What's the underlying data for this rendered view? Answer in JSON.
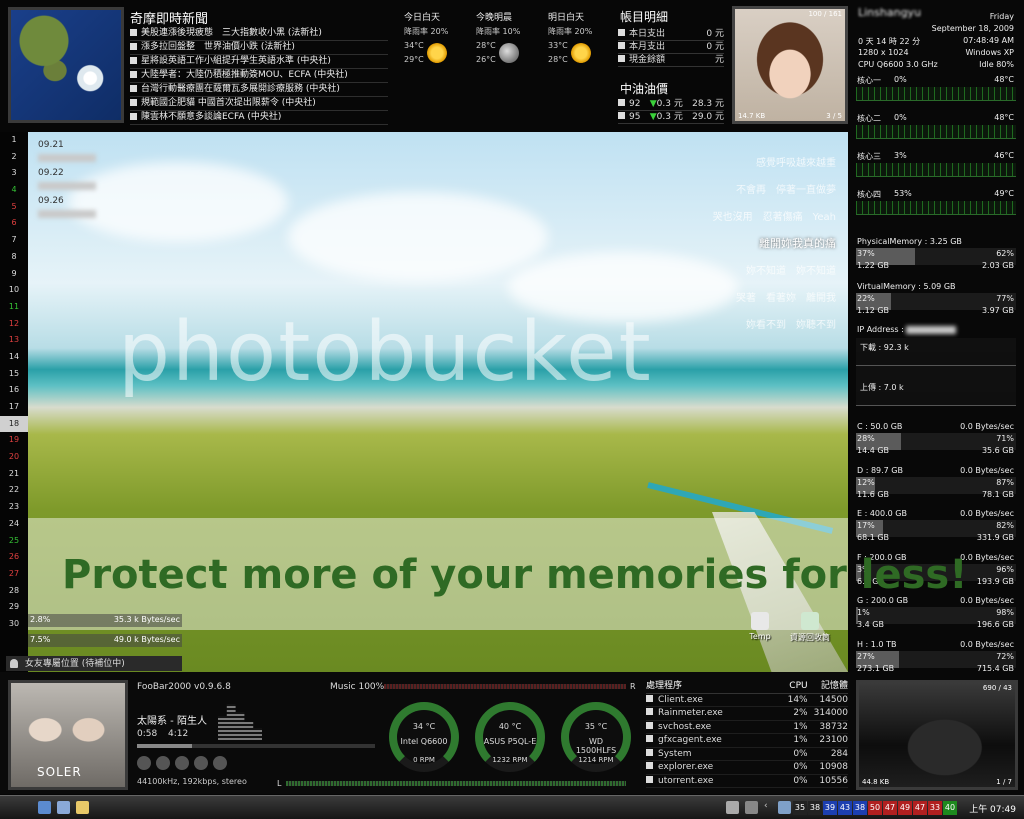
{
  "news": {
    "title": "奇摩即時新聞",
    "items": [
      "美股連漲後現疲態　三大指數收小黑 (法新社)",
      "漲多拉回盤整　世界油價小跌 (法新社)",
      "星將設英語工作小組提升學生英語水準 (中央社)",
      "大陸學者：大陸仍積極推動簽MOU、ECFA (中央社)",
      "台灣行動醫療團在薩爾瓦多展開診療服務 (中央社)",
      "規範國企肥貓 中國首次提出限薪令 (中央社)",
      "陳雲林不願意多談論ECFA (中央社)"
    ]
  },
  "weather": [
    {
      "label": "今日白天",
      "rain": "降雨率 20%",
      "hi": "34°C",
      "lo": "29°C",
      "icon": "sunny-icon"
    },
    {
      "label": "今晚明晨",
      "rain": "降雨率 10%",
      "hi": "28°C",
      "lo": "26°C",
      "icon": "night-clear-icon"
    },
    {
      "label": "明日白天",
      "rain": "降雨率 20%",
      "hi": "33°C",
      "lo": "28°C",
      "icon": "sunny-icon"
    }
  ],
  "account": {
    "title": "帳目明細",
    "rows": [
      {
        "label": "本日支出",
        "value": "0 元"
      },
      {
        "label": "本月支出",
        "value": "0 元"
      },
      {
        "label": "現金餘額",
        "value": "元"
      }
    ]
  },
  "fuel": {
    "title": "中油油價",
    "rows": [
      {
        "grade": "92",
        "change": "0.3 元",
        "price": "28.3 元"
      },
      {
        "grade": "95",
        "change": "0.3 元",
        "price": "29.0 元"
      }
    ]
  },
  "photo": {
    "top_label": "100 / 161",
    "bottom_left": "14.7 KB",
    "bottom_right": "3 / 5"
  },
  "system": {
    "user": "Linshangyu",
    "day": "Friday",
    "date": "September 18, 2009",
    "uptime": "0 天 14 時 22 分",
    "time": "07:48:49 AM",
    "resolution": "1280 x 1024",
    "os": "Windows XP",
    "cpu": "CPU Q6600 3.0 GHz",
    "idle": "Idle 80%",
    "cores": [
      {
        "name": "核心一",
        "load": "0%",
        "temp": "48°C"
      },
      {
        "name": "核心二",
        "load": "0%",
        "temp": "48°C"
      },
      {
        "name": "核心三",
        "load": "3%",
        "temp": "46°C"
      },
      {
        "name": "核心四",
        "load": "53%",
        "temp": "49°C"
      }
    ],
    "physical": {
      "title": "PhysicalMemory : 3.25 GB",
      "used_pct": "37%",
      "free_pct": "62%",
      "used": "1.22 GB",
      "free": "2.03 GB",
      "fraction": 0.37
    },
    "virtual": {
      "title": "VirtualMemory : 5.09 GB",
      "used_pct": "22%",
      "free_pct": "77%",
      "used": "1.12 GB",
      "free": "3.97 GB",
      "fraction": 0.22
    },
    "ip_label": "IP Address :",
    "download": "下載 : 92.3 k",
    "upload": "上傳 : 7.0 k",
    "drives": [
      {
        "name": "C : 50.0 GB",
        "speed": "0.0 Bytes/sec",
        "used_pct": "28%",
        "free_pct": "71%",
        "used": "14.4 GB",
        "free": "35.6 GB",
        "fraction": 0.28
      },
      {
        "name": "D : 89.7 GB",
        "speed": "0.0 Bytes/sec",
        "used_pct": "12%",
        "free_pct": "87%",
        "used": "11.6 GB",
        "free": "78.1 GB",
        "fraction": 0.12
      },
      {
        "name": "E : 400.0 GB",
        "speed": "0.0 Bytes/sec",
        "used_pct": "17%",
        "free_pct": "82%",
        "used": "68.1 GB",
        "free": "331.9 GB",
        "fraction": 0.17
      },
      {
        "name": "F : 200.0 GB",
        "speed": "0.0 Bytes/sec",
        "used_pct": "3%",
        "free_pct": "96%",
        "used": "6.1 GB",
        "free": "193.9 GB",
        "fraction": 0.03
      },
      {
        "name": "G : 200.0 GB",
        "speed": "0.0 Bytes/sec",
        "used_pct": "1%",
        "free_pct": "98%",
        "used": "3.4 GB",
        "free": "196.6 GB",
        "fraction": 0.01
      },
      {
        "name": "H : 1.0 TB",
        "speed": "0.0 Bytes/sec",
        "used_pct": "27%",
        "free_pct": "72%",
        "used": "273.1 GB",
        "free": "715.4 GB",
        "fraction": 0.27
      }
    ]
  },
  "calendar": {
    "days": [
      "1",
      "2",
      "3",
      "4",
      "5",
      "6",
      "7",
      "8",
      "9",
      "10",
      "11",
      "12",
      "13",
      "14",
      "15",
      "16",
      "17",
      "18",
      "19",
      "20",
      "21",
      "22",
      "23",
      "24",
      "25",
      "26",
      "27",
      "28",
      "29",
      "30"
    ],
    "colors": {
      "weekday": "#dddddd",
      "saturday": "#35c235",
      "sunday": "#e04040",
      "today": "#222222"
    }
  },
  "notes": [
    {
      "date": "09.21"
    },
    {
      "date": "09.22"
    },
    {
      "date": "09.26"
    }
  ],
  "lyrics": [
    "感覺呼吸越來越重",
    "不會再　停著一直做夢",
    "哭也沒用　忍著傷痛　Yeah",
    "離開妳我真的痛",
    "妳不知道　妳不知道",
    "哭著　看著妳　離開我",
    "妳看不到　妳聽不到"
  ],
  "watermark": "photobucket",
  "watermark_sub": "Protect more of your memories for less!",
  "network_mini": [
    {
      "pct": "2.8%",
      "speed": "35.3 k Bytes/sec"
    },
    {
      "pct": "7.5%",
      "speed": "49.0 k Bytes/sec"
    }
  ],
  "desktop_icons": [
    {
      "label": "Temp",
      "icon": "folder-icon"
    },
    {
      "label": "資源回收筒",
      "icon": "recycle-bin-icon"
    }
  ],
  "status_line": "女友專屬位置 (待補位中)",
  "player": {
    "app": "FooBar2000 v0.9.6.8",
    "volume": "Music 100%",
    "track": "太陽系 - 陌生人",
    "elapsed": "0:58",
    "duration": "4:12",
    "format": "44100kHz, 192kbps, stereo",
    "album_text": "SOLER",
    "right_channel": "R",
    "left_channel": "L",
    "progress": 0.23
  },
  "gauges": [
    {
      "temp": "34 °C",
      "name": "Intel Q6600",
      "rpm": "0 RPM"
    },
    {
      "temp": "40 °C",
      "name": "ASUS P5QL-E",
      "rpm": "1232 RPM"
    },
    {
      "temp": "35 °C",
      "name": "WD 1500HLFS",
      "rpm": "1214 RPM"
    }
  ],
  "processes": {
    "headers": [
      "處理程序",
      "CPU",
      "記憶體"
    ],
    "rows": [
      [
        "Client.exe",
        "14%",
        "14500"
      ],
      [
        "Rainmeter.exe",
        "2%",
        "314000"
      ],
      [
        "svchost.exe",
        "1%",
        "38732"
      ],
      [
        "gfxcagent.exe",
        "1%",
        "23100"
      ],
      [
        "System",
        "0%",
        "284"
      ],
      [
        "explorer.exe",
        "0%",
        "10908"
      ],
      [
        "utorrent.exe",
        "0%",
        "10556"
      ]
    ]
  },
  "car_photo": {
    "top_label": "690 / 43",
    "bottom_left": "44.8 KB",
    "bottom_right": "1 / 7"
  },
  "taskbar": {
    "numbers": [
      "35",
      "38",
      "39",
      "43",
      "38",
      "50",
      "47",
      "49",
      "47",
      "33",
      "40"
    ],
    "number_colors": [
      "#222",
      "#222",
      "#1c3fb0",
      "#1c3fb0",
      "#1c3fb0",
      "#b02020",
      "#b02020",
      "#b02020",
      "#b02020",
      "#b02020",
      "#1e8a1e"
    ],
    "clock": "上午 07:49"
  }
}
